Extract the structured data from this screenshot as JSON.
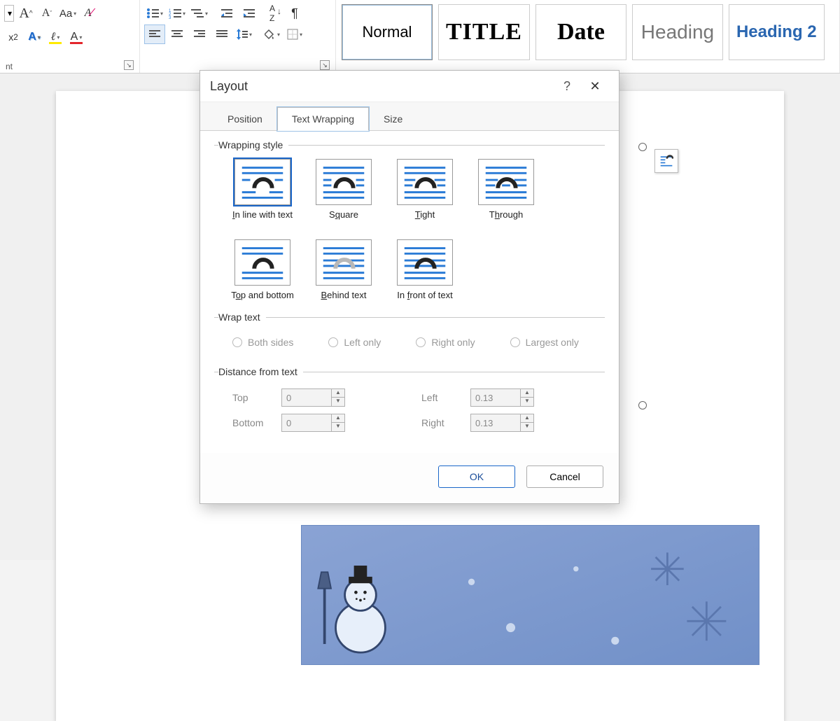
{
  "ribbon": {
    "font_group_label": "nt",
    "styles": [
      {
        "label": "Normal",
        "cls": "sel",
        "css": "font-size:22px;"
      },
      {
        "label": "TITLE",
        "cls": "",
        "css": "font-family:Impact,Arial Black;font-weight:900;font-size:34px;letter-spacing:1px;"
      },
      {
        "label": "Date",
        "cls": "",
        "css": "font-family:Georgia,serif;font-weight:700;font-size:34px;"
      },
      {
        "label": "Heading",
        "cls": "",
        "css": "font-size:28px;color:#777;"
      },
      {
        "label": "Heading 2",
        "cls": "",
        "css": "font-size:24px;color:#2a66b0;font-weight:600;"
      }
    ]
  },
  "dialog": {
    "title": "Layout",
    "tabs": [
      {
        "id": "position",
        "label": "Position",
        "active": false
      },
      {
        "id": "textwrapping",
        "label": "Text Wrapping",
        "active": true
      },
      {
        "id": "size",
        "label": "Size",
        "active": false
      }
    ],
    "wrapping_style": {
      "legend": "Wrapping style",
      "options": [
        {
          "id": "inline",
          "label_pre": "",
          "u": "I",
          "label_post": "n line with text",
          "selected": true,
          "icon": "inline"
        },
        {
          "id": "square",
          "label_pre": "S",
          "u": "q",
          "label_post": "uare",
          "icon": "square"
        },
        {
          "id": "tight",
          "label_pre": "",
          "u": "T",
          "label_post": "ight",
          "icon": "tight"
        },
        {
          "id": "through",
          "label_pre": "T",
          "u": "h",
          "label_post": "rough",
          "icon": "through"
        },
        {
          "id": "topbottom",
          "label_pre": "T",
          "u": "o",
          "label_post": "p and bottom",
          "icon": "topbottom"
        },
        {
          "id": "behind",
          "label_pre": "",
          "u": "B",
          "label_post": "ehind text",
          "icon": "behind"
        },
        {
          "id": "infront",
          "label_pre": "In ",
          "u": "f",
          "label_post": "ront of text",
          "icon": "infront"
        }
      ]
    },
    "wrap_text": {
      "legend": "Wrap text",
      "options": [
        "Both sides",
        "Left only",
        "Right only",
        "Largest only"
      ]
    },
    "distance": {
      "legend": "Distance from text",
      "rows": [
        {
          "label": "Top",
          "value": "0\""
        },
        {
          "label": "Bottom",
          "value": "0\""
        },
        {
          "label": "Left",
          "value": "0.13\""
        },
        {
          "label": "Right",
          "value": "0.13\""
        }
      ]
    },
    "buttons": {
      "ok": "OK",
      "cancel": "Cancel"
    }
  }
}
